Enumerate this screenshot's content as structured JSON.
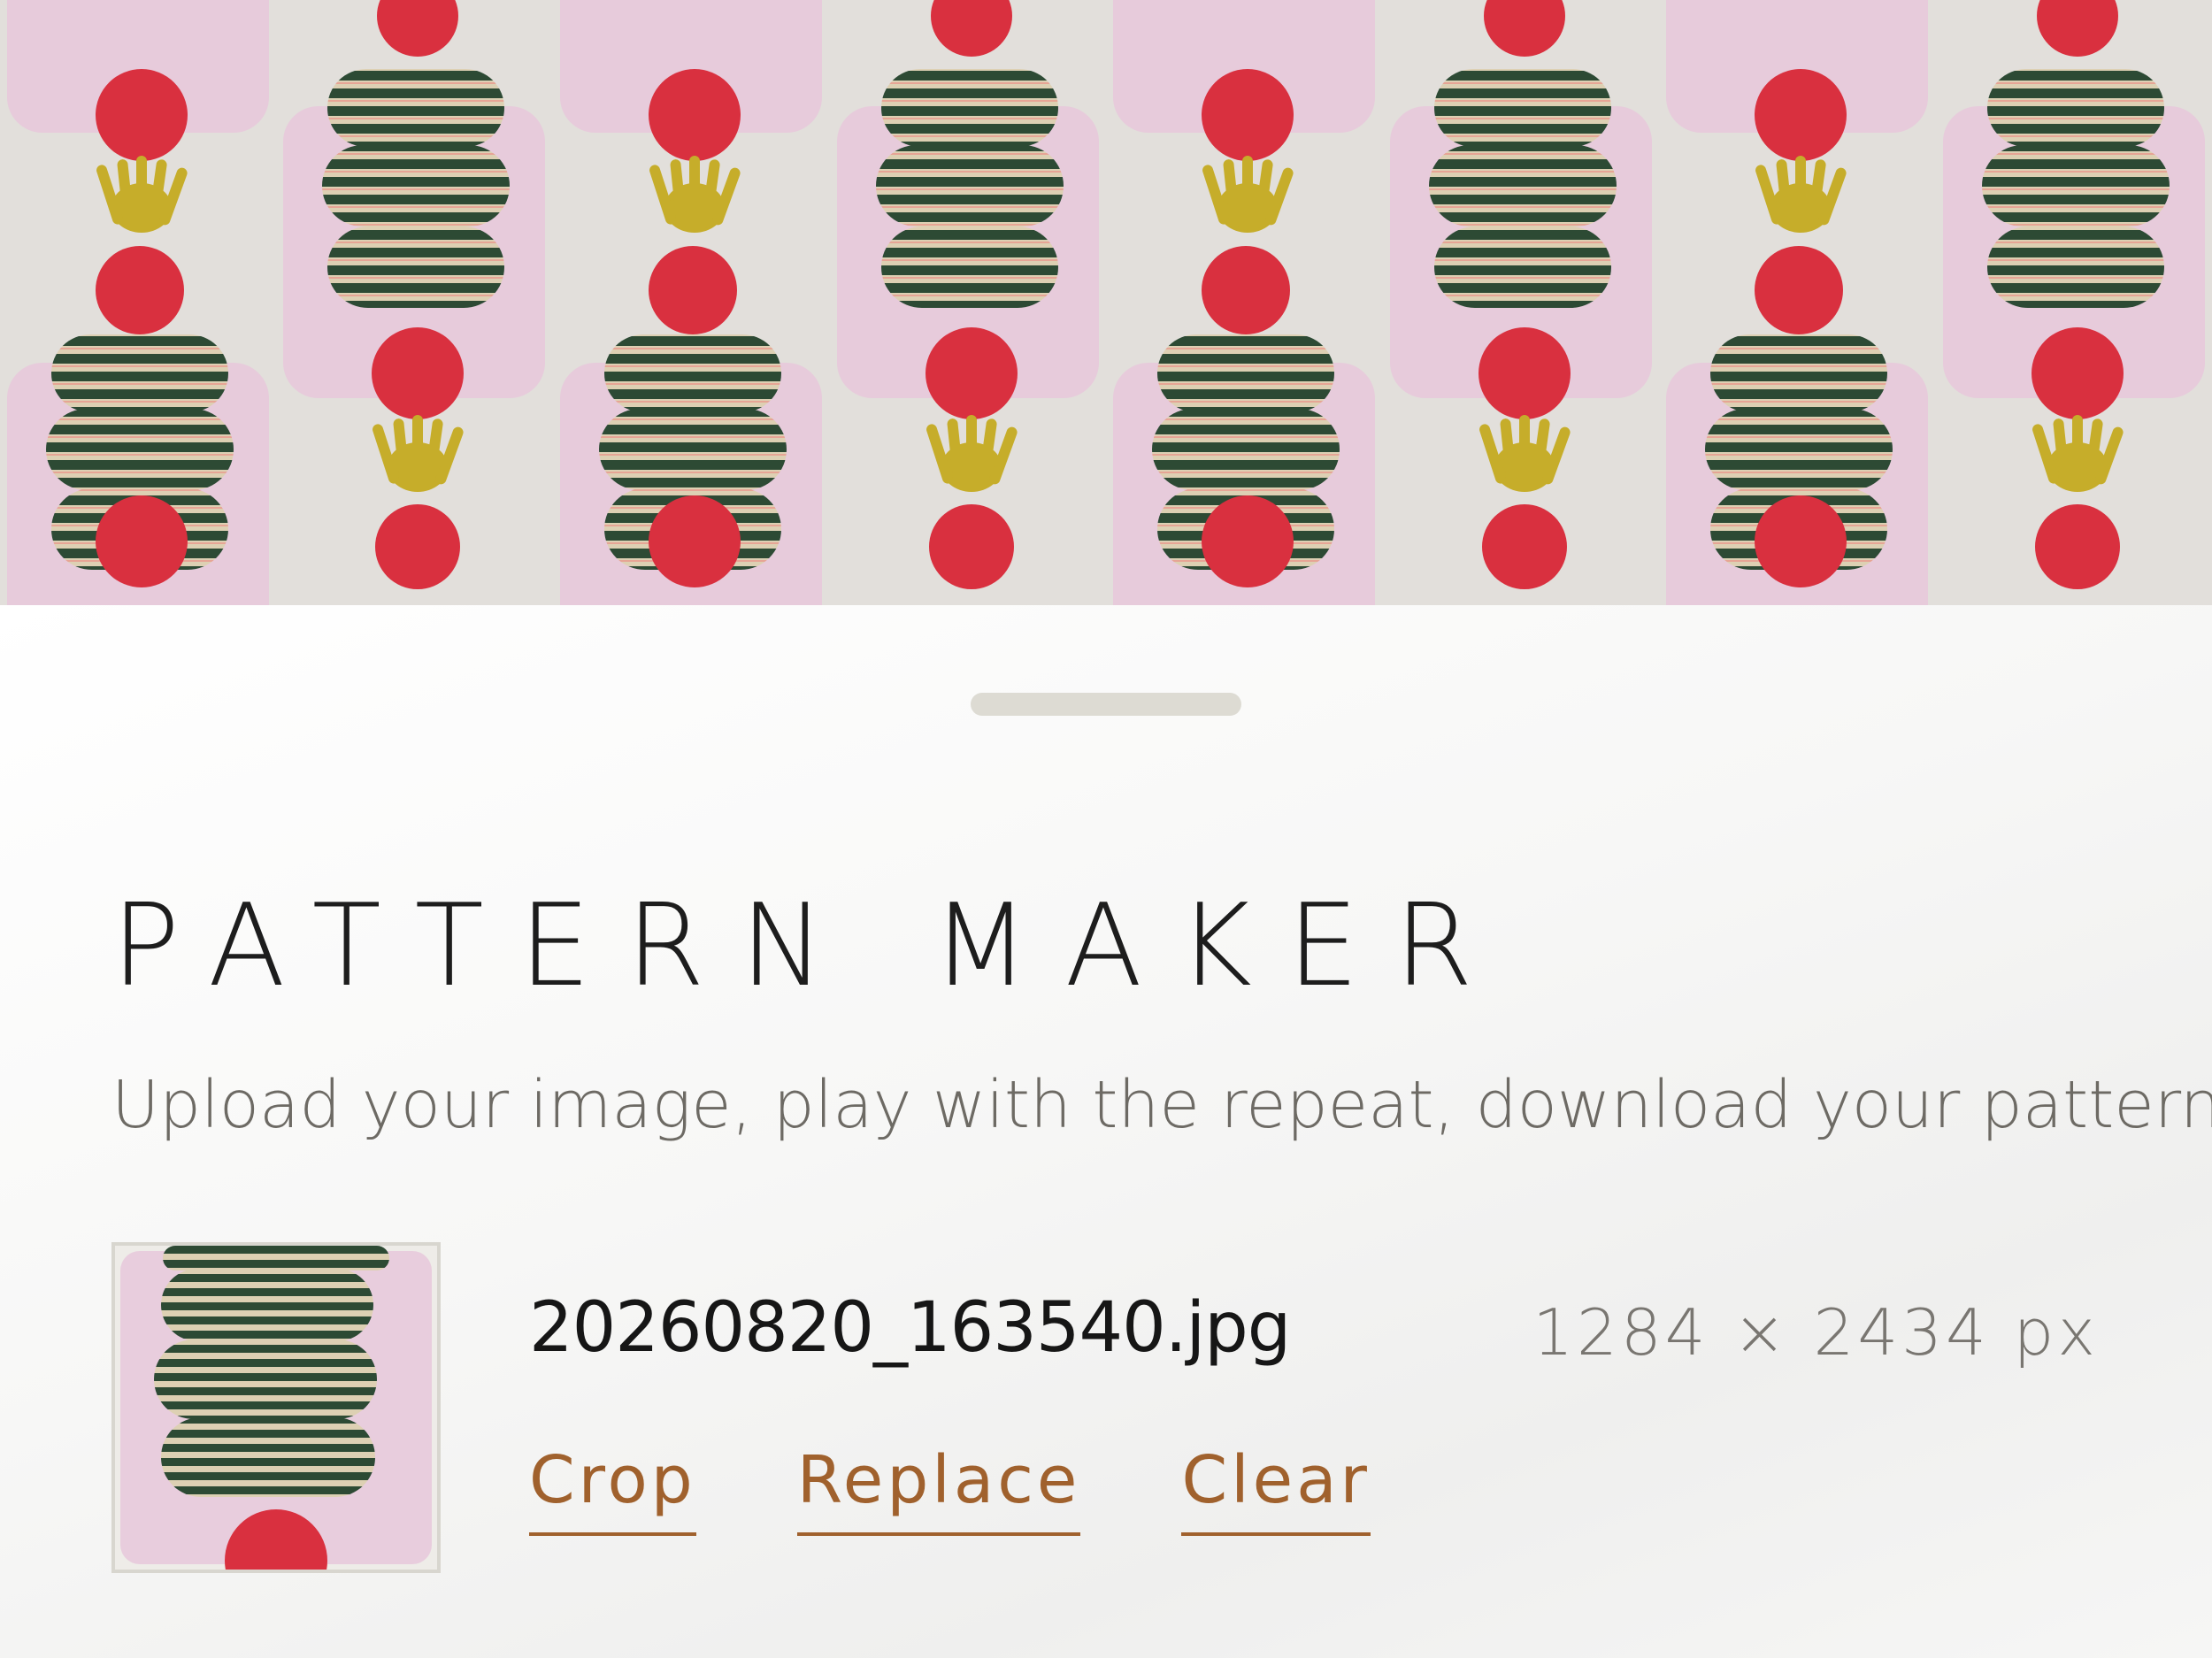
{
  "app": {
    "title": "PATTERN MAKER",
    "subtitle": "Upload your image, play with the repeat, download your pattern"
  },
  "preview": {
    "artwork": "collage-tile",
    "colors": {
      "background": "#e2dfdb",
      "pink": "#e9cfdf",
      "red": "#dc3443",
      "yellow": "#c6ad2a",
      "stripe_dark": "#2d4a34",
      "stripe_light": "#d9c8a8"
    }
  },
  "file": {
    "name": "20260820_163540.jpg",
    "dimensions": "1284 × 2434 px"
  },
  "actions": {
    "crop": "Crop",
    "replace": "Replace",
    "clear": "Clear"
  },
  "colors": {
    "accent": "#a0612d",
    "handle": "#dddbd3",
    "text": "#1d1d1d",
    "muted": "#6d6a64"
  }
}
